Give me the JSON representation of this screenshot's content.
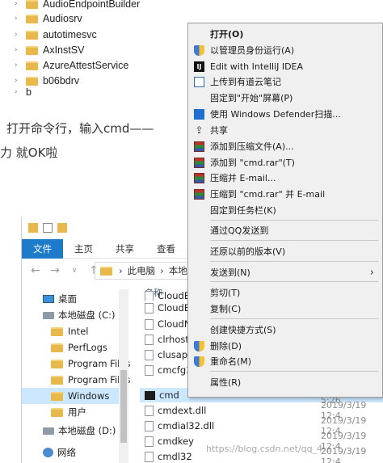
{
  "registry_tree": {
    "items": [
      "AudioEndpointBuilder",
      "Audiosrv",
      "autotimesvc",
      "AxInstSV",
      "AzureAttestService",
      "b06bdrv",
      "b"
    ]
  },
  "article": {
    "line1": "打开命令行，输入cmd——",
    "line2": "力  就OK啦"
  },
  "context_menu": {
    "items": [
      {
        "label": "打开(O)",
        "icon": "none",
        "bold": true
      },
      {
        "label": "以管理员身份运行(A)",
        "icon": "shield-icon"
      },
      {
        "label": "Edit with IntelliJ IDEA",
        "icon": "intellij-icon"
      },
      {
        "label": "上传到有道云笔记",
        "icon": "youdao-note-icon"
      },
      {
        "label": "固定到\"开始\"屏幕(P)",
        "icon": "none"
      },
      {
        "label": "使用 Windows Defender扫描...",
        "icon": "defender-icon"
      },
      {
        "label": "共享",
        "icon": "share-icon"
      },
      {
        "label": "添加到压缩文件(A)...",
        "icon": "winrar-icon"
      },
      {
        "label": "添加到 \"cmd.rar\"(T)",
        "icon": "winrar-icon"
      },
      {
        "label": "压缩并 E-mail...",
        "icon": "winrar-icon"
      },
      {
        "label": "压缩到 \"cmd.rar\" 并 E-mail",
        "icon": "winrar-icon"
      },
      {
        "label": "固定到任务栏(K)",
        "icon": "none"
      },
      {
        "label": "通过QQ发送到",
        "icon": "none"
      },
      {
        "label": "还原以前的版本(V)",
        "icon": "none"
      },
      {
        "label": "发送到(N)",
        "icon": "none",
        "submenu": true
      },
      {
        "label": "剪切(T)",
        "icon": "none"
      },
      {
        "label": "复制(C)",
        "icon": "none"
      },
      {
        "label": "创建快捷方式(S)",
        "icon": "none"
      },
      {
        "label": "删除(D)",
        "icon": "shield-icon"
      },
      {
        "label": "重命名(M)",
        "icon": "shield-icon"
      },
      {
        "label": "属性(R)",
        "icon": "none"
      }
    ],
    "submenu_arrow": "›"
  },
  "explorer": {
    "ribbon_tabs": [
      "文件",
      "主页",
      "共享",
      "查看"
    ],
    "nav_back": "←",
    "nav_forward": "→",
    "nav_dropdown": "∨",
    "nav_up": "↑",
    "address": [
      "此电脑",
      "本地磁"
    ],
    "address_sep": "›",
    "nav_items": [
      "桌面",
      "本地磁盘 (C:)",
      "Intel",
      "PerfLogs",
      "Program Files",
      "Program Files",
      "Windows",
      "用户",
      "本地磁盘 (D:)",
      "网络"
    ],
    "column_header": "名称",
    "files": [
      {
        "name": "CloudE",
        "date": ""
      },
      {
        "name": "CloudE",
        "date": ""
      },
      {
        "name": "CloudN",
        "date": ""
      },
      {
        "name": "clrhost",
        "date": ""
      },
      {
        "name": "clusapi",
        "date": ""
      },
      {
        "name": "cmcfg3",
        "date": ""
      },
      {
        "name": "cmd",
        "date": "2020/1/10 5:26"
      },
      {
        "name": "cmdext.dll",
        "date": "2019/3/19 12:4"
      },
      {
        "name": "cmdial32.dll",
        "date": "2019/3/19 12:4"
      },
      {
        "name": "cmdkey",
        "date": "2019/3/19 12:4"
      },
      {
        "name": "cmdl32",
        "date": "2019/3/19 12:4"
      }
    ]
  },
  "watermark": "https://blog.csdn.net/qq_4...",
  "colors": {
    "menu_bg": "#f0f0f0",
    "ribbon_file_tab": "#1e7bc9",
    "selection": "#cce8ff"
  }
}
